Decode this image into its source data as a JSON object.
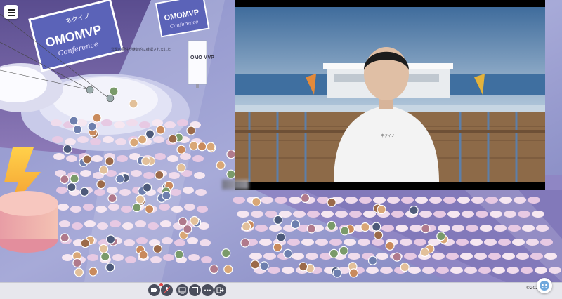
{
  "app": {
    "menu_icon": "hamburger-menu-icon"
  },
  "venue": {
    "logo_text": "ネクイノ",
    "logo_title": "OMOMVP",
    "logo_script": "Conference",
    "banner_title": "OMOMVP",
    "banner_script": "Conference",
    "stand_text": "OMO MVP",
    "board_text": "営業の要件が継続的に確認されました"
  },
  "video": {
    "shirt_text": "ネクイノ"
  },
  "toolbar": {
    "buttons": [
      "camera-icon",
      "microphone-muted-icon",
      "screen-share-icon",
      "video-icon",
      "more-icon",
      "exit-icon"
    ],
    "footer": "©202"
  },
  "help": {
    "icon": "help-avatar-icon"
  }
}
